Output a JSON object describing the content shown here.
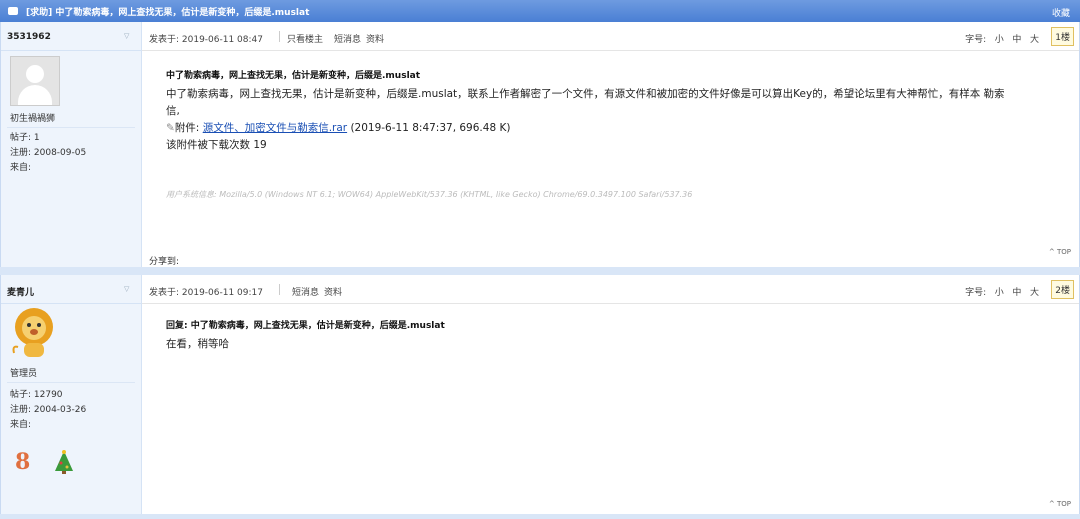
{
  "thread": {
    "title": "[求助] 中了勒索病毒，网上查找无果，估计是新变种，后缀是.muslat",
    "favorite_label": "收藏"
  },
  "posts": [
    {
      "username": "3531962",
      "rank": "初生禍禍狮",
      "stats": {
        "posts": "帖子: 1",
        "registered": "注册:  2008-09-05",
        "from": "来自:"
      },
      "posted": "发表于:  2019-06-11 08:47",
      "links": {
        "only_op": "只看楼主",
        "pm": "短消息",
        "profile": "资料"
      },
      "font_size": {
        "label": "字号:",
        "small": "小",
        "medium": "中",
        "large": "大"
      },
      "floor": "1楼",
      "subject": "中了勒索病毒，网上查找无果，估计是新变种，后缀是.muslat",
      "body_line1": "中了勒索病毒，网上查找无果，估计是新变种，后缀是.muslat，联系上作者解密了一个文件，有源文件和被加密的文件好像是可以算出Key的，希望论坛里有大神帮忙，有样本 勒索",
      "body_line2": "信,",
      "attachment": {
        "label": "附件:",
        "name": "源文件、加密文件与勒索信.rar",
        "meta": "(2019-6-11 8:47:37, 696.48 K)"
      },
      "downloads": "该附件被下载次数 19",
      "sysinfo": "用户系统信息:  Mozilla/5.0 (Windows NT 6.1; WOW64) AppleWebKit/537.36 (KHTML, like Gecko) Chrome/69.0.3497.100 Safari/537.36",
      "share": "分享到:",
      "top": "^ TOP"
    },
    {
      "username": "麦青儿",
      "rank": "管理员",
      "stats": {
        "posts": "帖子: 12790",
        "registered": "注册:  2004-03-26",
        "from": "来自:"
      },
      "posted": "发表于:  2019-06-11 09:17",
      "links": {
        "pm": "短消息",
        "profile": "资料"
      },
      "font_size": {
        "label": "字号:",
        "small": "小",
        "medium": "中",
        "large": "大"
      },
      "floor": "2楼",
      "subject": "回复:  中了勒索病毒，网上查找无果，估计是新变种，后缀是.muslat",
      "body": "在看，稍等哈",
      "badges": [
        "8",
        "tree-icon"
      ],
      "top": "^ TOP"
    }
  ],
  "colors": {
    "title_bar": "#4a7fd4",
    "sidebar": "#eef4fc",
    "link": "#1a4fb4",
    "divider": "#d9e6f7"
  }
}
